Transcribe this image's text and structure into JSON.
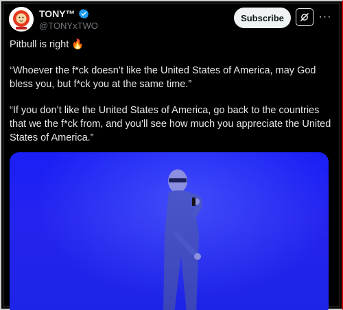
{
  "tweet": {
    "author_name": "TONY™",
    "author_handle": "@TONYxTWO",
    "subscribe_label": "Subscribe",
    "more_label": "···",
    "line1": "Pitbull is right ",
    "line1_emoji": "🔥",
    "quote1": "“Whoever the f*ck doesn’t like the United States of America, may God bless you, but f*ck you at the same time.”",
    "quote2": "“If you don’t like the United States of America, go back to the countries that we the f*ck from, and you’ll see how much you appreciate the United States of America.”"
  },
  "icons": {
    "verified": "verified-badge-icon",
    "grok": "grok-icon",
    "more": "more-icon",
    "avatar": "lion-logo-avatar"
  },
  "colors": {
    "background": "#000000",
    "text": "#e7e9ea",
    "secondary_text": "#71767b",
    "verified": "#1d9bf0",
    "subscribe_bg": "#eff3f4",
    "media_blue": "#1d24e6"
  }
}
